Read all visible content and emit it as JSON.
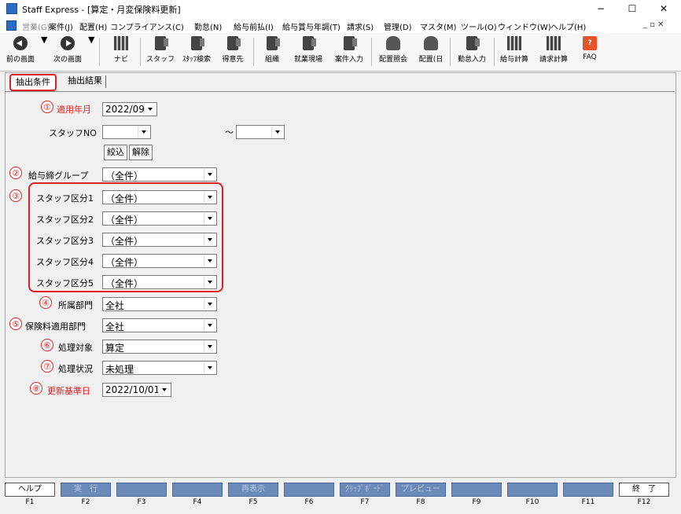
{
  "window": {
    "title": "Staff Express - [算定・月変保険料更新]",
    "minimize": "−",
    "maximize": "☐",
    "close": "✕"
  },
  "menu": {
    "items": [
      {
        "label": "営業(G)",
        "disabled": true
      },
      {
        "label": "案件(J)"
      },
      {
        "label": "配置(H)"
      },
      {
        "label": "コンプライアンス(C)"
      },
      {
        "label": "勤怠(N)"
      },
      {
        "label": "給与前払(I)"
      },
      {
        "label": "給与賞与年調(T)"
      },
      {
        "label": "請求(S)"
      },
      {
        "label": "管理(D)"
      },
      {
        "label": "マスタ(M)"
      },
      {
        "label": "ツール(O)"
      },
      {
        "label": "ウィンドウ(W)"
      },
      {
        "label": "ヘルプ(H)"
      }
    ],
    "mdi_controls": "_ ▫ ✕"
  },
  "toolbar": {
    "items": [
      {
        "label": "前の画面",
        "icon": "back-arrow-icon"
      },
      {
        "label": "次の画面",
        "icon": "forward-arrow-icon"
      },
      {
        "label": "ナビ",
        "icon": "navi-icon"
      },
      {
        "label": "スタッフ",
        "icon": "staff-icon"
      },
      {
        "label": "ｽﾀｯﾌ検索",
        "icon": "staff-search-icon"
      },
      {
        "label": "得意先",
        "icon": "client-icon"
      },
      {
        "label": "組織",
        "icon": "organization-icon"
      },
      {
        "label": "就業現場",
        "icon": "worksite-icon"
      },
      {
        "label": "案件入力",
        "icon": "case-entry-icon"
      },
      {
        "label": "配置照会",
        "icon": "placement-inquiry-icon"
      },
      {
        "label": "配置(日",
        "icon": "placement-daily-icon"
      },
      {
        "label": "勤怠入力",
        "icon": "attendance-entry-icon"
      },
      {
        "label": "給与計算",
        "icon": "payroll-calc-icon"
      },
      {
        "label": "請求計算",
        "icon": "billing-calc-icon"
      },
      {
        "label": "FAQ",
        "icon": "faq-icon"
      }
    ]
  },
  "tabs": [
    {
      "label": "抽出条件",
      "active": true
    },
    {
      "label": "抽出結果",
      "active": false
    }
  ],
  "form": {
    "apply_month": {
      "num": "①",
      "label": "適用年月",
      "value": "2022/09"
    },
    "staff_no": {
      "label": "スタッフNO",
      "from": "",
      "to": "",
      "sep": "～"
    },
    "filter_button": "絞込",
    "clear_button": "解除",
    "pay_group": {
      "num": "②",
      "label": "給与締グループ",
      "value": "（全件）"
    },
    "staff_class_num": "③",
    "staff_class": [
      {
        "label": "スタッフ区分1",
        "value": "（全件）"
      },
      {
        "label": "スタッフ区分2",
        "value": "（全件）"
      },
      {
        "label": "スタッフ区分3",
        "value": "（全件）"
      },
      {
        "label": "スタッフ区分4",
        "value": "（全件）"
      },
      {
        "label": "スタッフ区分5",
        "value": "（全件）"
      }
    ],
    "department": {
      "num": "④",
      "label": "所属部門",
      "value": "全社"
    },
    "insurance_dept": {
      "num": "⑤",
      "label": "保険料適用部門",
      "value": "全社"
    },
    "target": {
      "num": "⑥",
      "label": "処理対象",
      "value": "算定"
    },
    "status": {
      "num": "⑦",
      "label": "処理状況",
      "value": "未処理"
    },
    "base_date": {
      "num": "⑧",
      "label": "更新基準日",
      "value": "2022/10/01"
    }
  },
  "fkeys": [
    {
      "label": "ヘルプ",
      "key": "F1",
      "enabled": true
    },
    {
      "label": "実　行",
      "key": "F2",
      "enabled": false
    },
    {
      "label": "",
      "key": "F3",
      "enabled": false
    },
    {
      "label": "",
      "key": "F4",
      "enabled": false
    },
    {
      "label": "再表示",
      "key": "F5",
      "enabled": false
    },
    {
      "label": "",
      "key": "F6",
      "enabled": false
    },
    {
      "label": "ｸﾘｯﾌﾟﾎﾞｰﾄﾞ",
      "key": "F7",
      "enabled": false
    },
    {
      "label": "プレビュー",
      "key": "F8",
      "enabled": false
    },
    {
      "label": "",
      "key": "F9",
      "enabled": false
    },
    {
      "label": "",
      "key": "F10",
      "enabled": false
    },
    {
      "label": "",
      "key": "F11",
      "enabled": false
    },
    {
      "label": "終　了",
      "key": "F12",
      "enabled": true
    }
  ],
  "colors": {
    "accent_red": "#e02020",
    "fkey_blue": "#6c8ab8"
  }
}
